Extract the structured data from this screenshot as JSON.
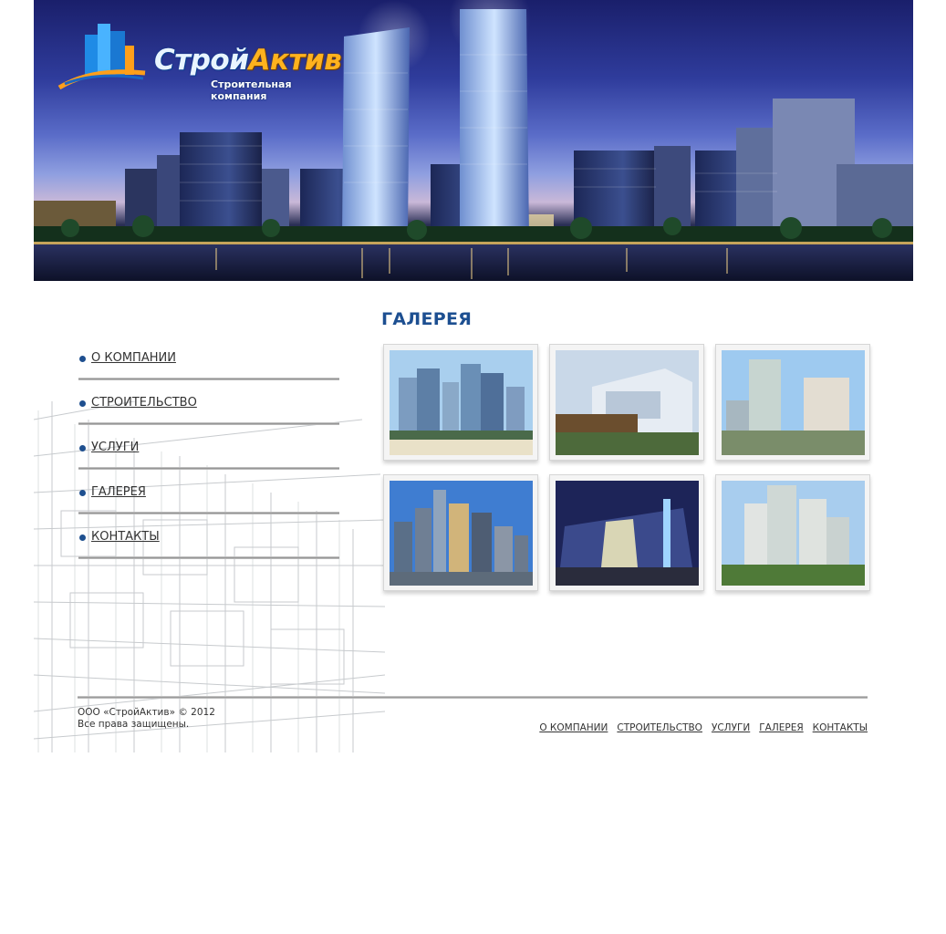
{
  "header": {
    "logo_name_part1": "Строй",
    "logo_name_part2": "Актив",
    "logo_subtitle": "Строительная компания"
  },
  "sidebar": {
    "items": [
      {
        "label": "О КОМПАНИИ"
      },
      {
        "label": "СТРОИТЕЛЬСТВО"
      },
      {
        "label": "УСЛУГИ"
      },
      {
        "label": "ГАЛЕРЕЯ"
      },
      {
        "label": "КОНТАКТЫ"
      }
    ]
  },
  "main": {
    "title": "ГАЛЕРЕЯ",
    "gallery_count": 6
  },
  "footer": {
    "copyright_line1": "ООО «СтройАктив» © 2012",
    "copyright_line2": "Все права защищены.",
    "nav": [
      {
        "label": "О КОМПАНИИ"
      },
      {
        "label": "СТРОИТЕЛЬСТВО"
      },
      {
        "label": "УСЛУГИ"
      },
      {
        "label": "ГАЛЕРЕЯ"
      },
      {
        "label": "КОНТАКТЫ"
      }
    ]
  },
  "colors": {
    "accent_blue": "#1d4f91",
    "logo_orange": "#ffb21e",
    "bullet": "#1e4f8f"
  }
}
